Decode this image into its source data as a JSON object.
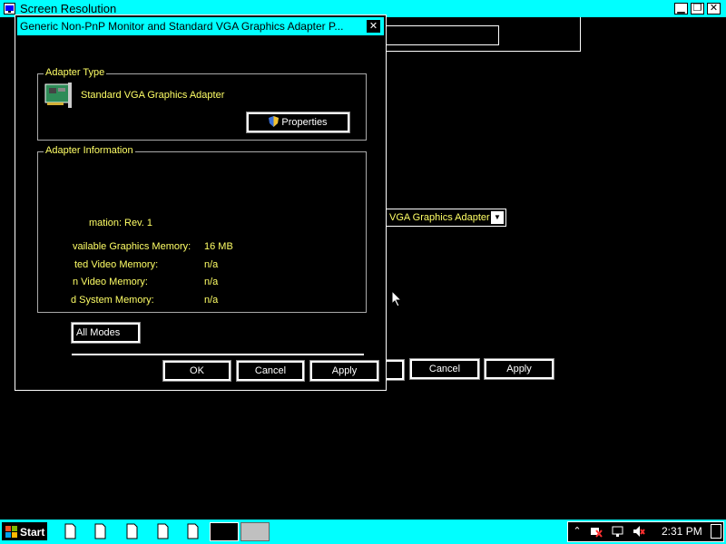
{
  "background_window": {
    "title": "Screen Resolution",
    "dropdown_value": "VGA Graphics Adapter",
    "buttons": {
      "cancel": "Cancel",
      "apply": "Apply"
    }
  },
  "dialog": {
    "title": "Generic Non-PnP Monitor and Standard VGA Graphics Adapter P...",
    "adapter_type": {
      "legend": "Adapter Type",
      "adapter_name": "Standard VGA Graphics Adapter",
      "properties_label": "Properties"
    },
    "adapter_info": {
      "legend": "Adapter Information",
      "rows": [
        {
          "label": "mation:",
          "value": "Rev. 1"
        },
        {
          "label": "vailable Graphics Memory:",
          "value": "16 MB"
        },
        {
          "label": "ted Video Memory:",
          "value": "n/a"
        },
        {
          "label": "n Video Memory:",
          "value": "n/a"
        },
        {
          "label": "d System Memory:",
          "value": "n/a"
        }
      ]
    },
    "list_modes_label": "All Modes",
    "buttons": {
      "ok": "OK",
      "cancel": "Cancel",
      "apply": "Apply"
    }
  },
  "taskbar": {
    "start_label": "Start",
    "clock": "2:31 PM"
  },
  "colors": {
    "highlight": "#00ffff",
    "text_yellow": "#ffff66",
    "background": "#000000"
  }
}
